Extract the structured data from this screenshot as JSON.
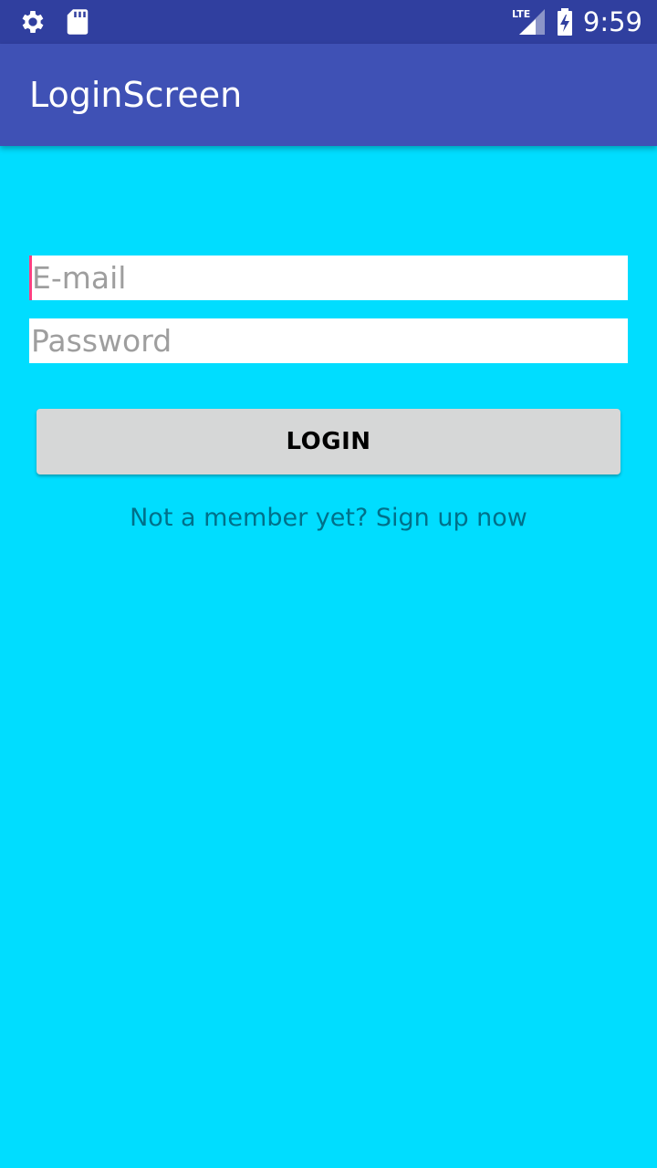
{
  "status_bar": {
    "left_icons": [
      "settings-gear-icon",
      "sd-card-icon"
    ],
    "network_label": "LTE",
    "time": "9:59"
  },
  "app_bar": {
    "title": "LoginScreen"
  },
  "form": {
    "email_placeholder": "E-mail",
    "password_placeholder": "Password",
    "login_label": "LOGIN",
    "signup_text": "Not a member yet? Sign up now"
  },
  "colors": {
    "status_bar": "#303F9F",
    "app_bar": "#3F51B5",
    "background": "#00DDFF",
    "accent": "#FF4081",
    "button": "#D6D7D7",
    "link_text": "#00708A"
  }
}
